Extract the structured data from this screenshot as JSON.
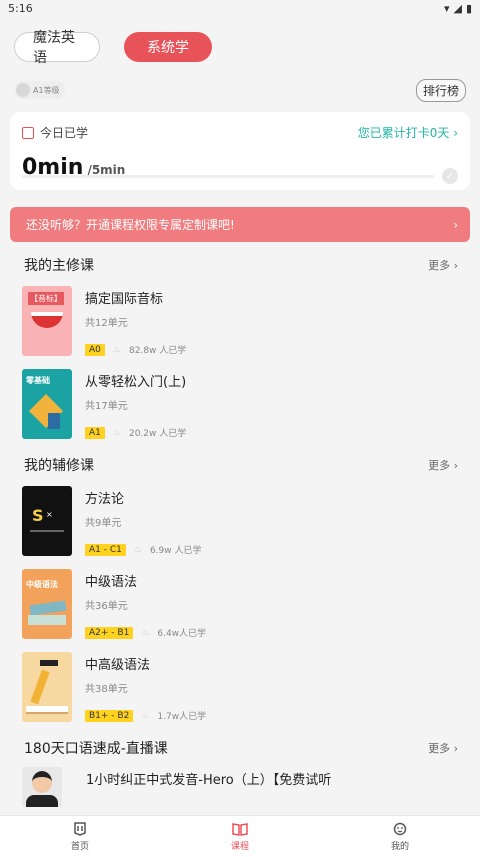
{
  "status_bar": {
    "time": "5:16"
  },
  "top_tabs": [
    {
      "label": "魔法英语",
      "active": false
    },
    {
      "label": "系统学",
      "active": true
    }
  ],
  "level_badge": "A1等级",
  "rank_button": "排行榜",
  "study_card": {
    "label": "今日已学",
    "streak_text": "您已累计打卡0天",
    "time_value": "0min",
    "time_goal": "/5min",
    "progress": 0
  },
  "banner": {
    "text": "还没听够？开通课程权限专属定制课吧!"
  },
  "major_section": {
    "title": "我的主修课",
    "more": "更多",
    "courses": [
      {
        "cover_label": "【音标】",
        "title": "搞定国际音标",
        "units": "共12单元",
        "level": "A0",
        "learners": "82.8w  人已学"
      },
      {
        "cover_label": "零基础",
        "title": "从零轻松入门(上)",
        "units": "共17单元",
        "level": "A1",
        "learners": "20.2w  人已学"
      }
    ]
  },
  "minor_section": {
    "title": "我的辅修课",
    "more": "更多",
    "courses": [
      {
        "title": "方法论",
        "units": "共9单元",
        "level": "A1 - C1",
        "learners": "6.9w 人已学"
      },
      {
        "cover_label": "中级语法",
        "title": "中级语法",
        "units": "共36单元",
        "level": "A2+ - B1",
        "learners": "6.4w人已学"
      },
      {
        "title": "中高级语法",
        "units": "共38单元",
        "level": "B1+ - B2",
        "learners": "1.7w人已学"
      }
    ]
  },
  "live_section": {
    "title": "180天口语速成-直播课",
    "more": "更多",
    "item": {
      "title": "1小时纠正中式发音-Hero（上）【免费试听"
    }
  },
  "bottom_nav": [
    {
      "label": "首页",
      "active": false
    },
    {
      "label": "课程",
      "active": true
    },
    {
      "label": "我的",
      "active": false
    }
  ]
}
